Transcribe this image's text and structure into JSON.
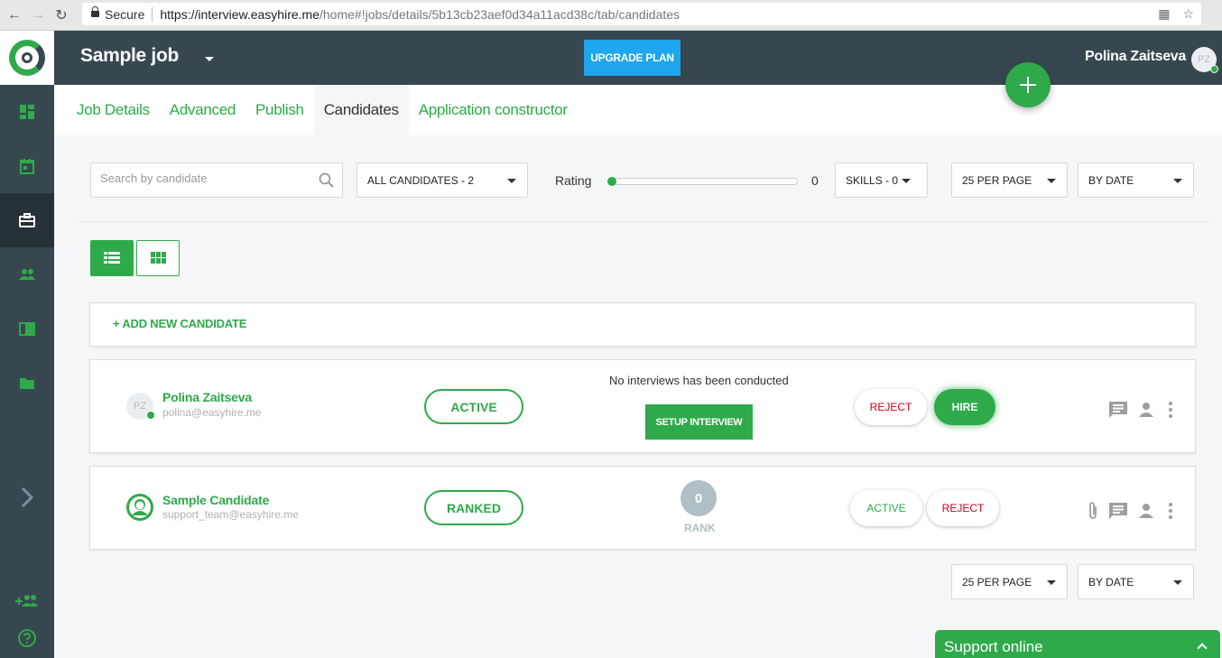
{
  "browser": {
    "secure_label": "Secure",
    "url_host": "https://interview.easyhire.me",
    "url_path": "/home#!jobs/details/5b13cb23aef0d34a11acd38c/tab/candidates"
  },
  "header": {
    "job_title": "Sample job",
    "upgrade_label": "UPGRADE PLAN",
    "user_name": "Polina Zaitseva",
    "user_initials": "PZ"
  },
  "tabs": [
    {
      "label": "Job Details"
    },
    {
      "label": "Advanced"
    },
    {
      "label": "Publish"
    },
    {
      "label": "Candidates"
    },
    {
      "label": "Application constructor"
    }
  ],
  "filters": {
    "search_placeholder": "Search by candidate",
    "candidates_select": "ALL CANDIDATES - 2",
    "rating_label": "Rating",
    "rating_value": "0",
    "skills_select": "SKILLS - 0",
    "per_page": "25 PER PAGE",
    "sort": "BY DATE"
  },
  "add_candidate_label": "+ ADD NEW CANDIDATE",
  "candidates": [
    {
      "initials": "PZ",
      "name": "Polina Zaitseva",
      "email": "polina@easyhire.me",
      "status": "ACTIVE",
      "interview_note": "No interviews has been conducted",
      "setup_label": "SETUP INTERVIEW",
      "reject_label": "REJECT",
      "hire_label": "HIRE"
    },
    {
      "name": "Sample Candidate",
      "email": "support_team@easyhire.me",
      "status": "RANKED",
      "rank_value": "0",
      "rank_label": "RANK",
      "active_label": "ACTIVE",
      "reject_label": "REJECT"
    }
  ],
  "bottom_filters": {
    "per_page": "25 PER PAGE",
    "sort": "BY DATE"
  },
  "support_label": "Support online",
  "colors": {
    "brand_green": "#2eaa4a",
    "sidebar": "#37474f",
    "upgrade_blue": "#1ea6ee",
    "reject_red": "#d0021b"
  }
}
